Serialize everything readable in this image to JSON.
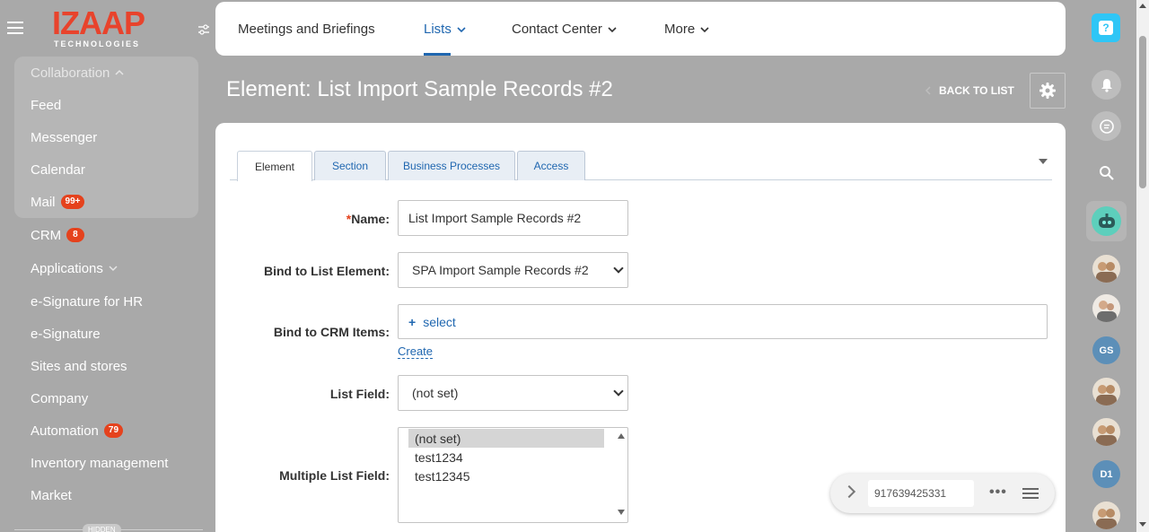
{
  "logo": {
    "brand": "IZAAP",
    "sub": "TECHNOLOGIES"
  },
  "sidebar": {
    "group_title": "Collaboration",
    "group_items": [
      {
        "label": "Feed"
      },
      {
        "label": "Messenger"
      },
      {
        "label": "Calendar"
      },
      {
        "label": "Mail",
        "badge": "99+"
      }
    ],
    "items": [
      {
        "label": "CRM",
        "badge": "8"
      },
      {
        "label": "Applications"
      },
      {
        "label": "e-Signature for HR"
      },
      {
        "label": "e-Signature"
      },
      {
        "label": "Sites and stores"
      },
      {
        "label": "Company"
      },
      {
        "label": "Automation",
        "badge": "79"
      },
      {
        "label": "Inventory management"
      },
      {
        "label": "Market"
      }
    ],
    "hidden_label": "HIDDEN"
  },
  "topnav": {
    "tabs": [
      {
        "label": "Meetings and Briefings"
      },
      {
        "label": "Lists"
      },
      {
        "label": "Contact Center"
      },
      {
        "label": "More"
      }
    ]
  },
  "page": {
    "title": "Element: List Import Sample Records #2",
    "back_label": "BACK TO LIST"
  },
  "form": {
    "tabs": [
      {
        "label": "Element"
      },
      {
        "label": "Section"
      },
      {
        "label": "Business Processes"
      },
      {
        "label": "Access"
      }
    ],
    "name_label": "Name:",
    "name_value": "List Import Sample Records #2",
    "bind_list_label": "Bind to List Element:",
    "bind_list_value": "SPA Import Sample Records #2",
    "bind_crm_label": "Bind to CRM Items:",
    "bind_crm_select": "select",
    "create_label": "Create",
    "list_field_label": "List Field:",
    "list_field_value": "(not set)",
    "multi_label": "Multiple List Field:",
    "multi_options": [
      "(not set)",
      "test1234",
      "test12345"
    ]
  },
  "phone": {
    "number": "917639425331"
  },
  "rightbar": {
    "avatars_initials": [
      "GS",
      "D1"
    ]
  },
  "colors": {
    "accent": "#2067b0",
    "badge": "#e5421d",
    "brand": "#e8432c",
    "help": "#2fc6f6"
  }
}
